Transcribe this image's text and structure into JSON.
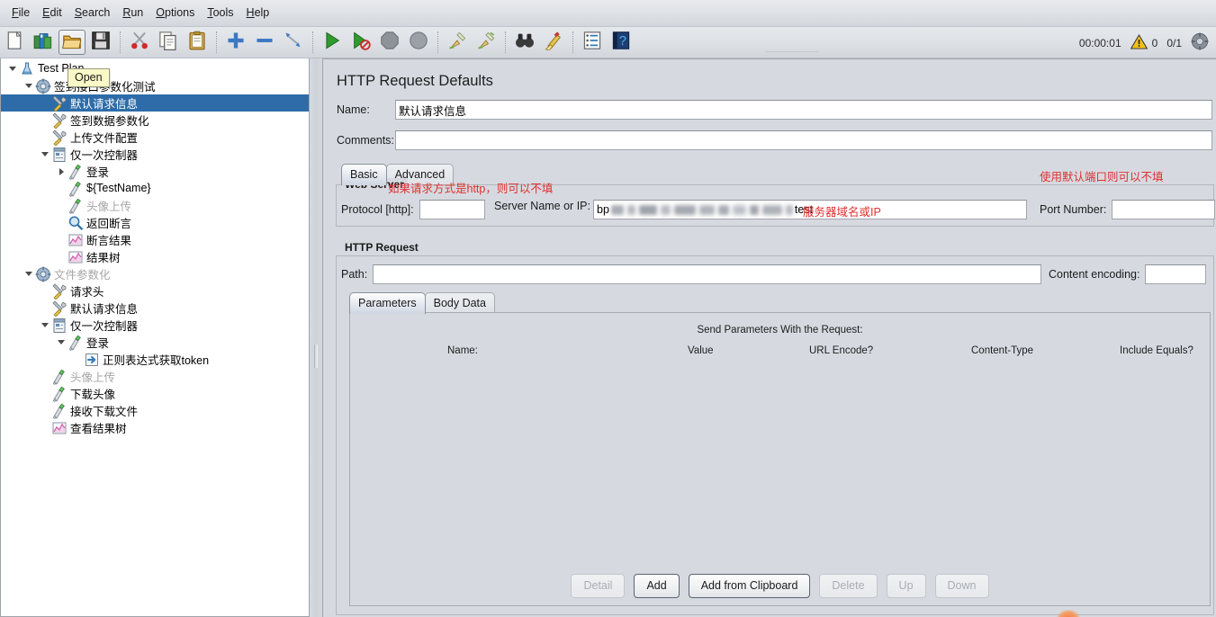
{
  "window": {
    "app": "Apache JMeter",
    "bg_color": "#d6dae0",
    "accent_selection": "#2d6ca8",
    "annotation_color": "#e03030"
  },
  "menubar": {
    "items": [
      {
        "label": "File",
        "mnemonic": "F"
      },
      {
        "label": "Edit",
        "mnemonic": "E"
      },
      {
        "label": "Search",
        "mnemonic": "S"
      },
      {
        "label": "Run",
        "mnemonic": "R"
      },
      {
        "label": "Options",
        "mnemonic": "O"
      },
      {
        "label": "Tools",
        "mnemonic": "T"
      },
      {
        "label": "Help",
        "mnemonic": "H"
      }
    ]
  },
  "toolbar": {
    "groups": [
      [
        {
          "icon": "new-file-icon",
          "title": "New"
        },
        {
          "icon": "templates-icon",
          "title": "Templates"
        },
        {
          "icon": "open-folder-icon",
          "title": "Open",
          "pressed": true
        },
        {
          "icon": "save-floppy-icon",
          "title": "Save Test Plan"
        }
      ],
      [
        {
          "icon": "cut-scissors-icon",
          "title": "Cut"
        },
        {
          "icon": "copy-pages-icon",
          "title": "Copy"
        },
        {
          "icon": "paste-clipboard-icon",
          "title": "Paste"
        }
      ],
      [
        {
          "icon": "expand-plus-icon",
          "title": "Expand All"
        },
        {
          "icon": "collapse-minus-icon",
          "title": "Collapse All"
        },
        {
          "icon": "toggle-branch-icon",
          "title": "Toggle"
        }
      ],
      [
        {
          "icon": "start-play-icon",
          "title": "Start"
        },
        {
          "icon": "start-no-timers-icon",
          "title": "Start no pauses"
        },
        {
          "icon": "stop-octagon-icon",
          "title": "Stop"
        },
        {
          "icon": "shutdown-icon",
          "title": "Shutdown"
        }
      ],
      [
        {
          "icon": "clear-broom-icon",
          "title": "Clear"
        },
        {
          "icon": "clear-all-broom-icon",
          "title": "Clear All"
        }
      ],
      [
        {
          "icon": "search-binoculars-icon",
          "title": "Search"
        },
        {
          "icon": "reset-search-broom-icon",
          "title": "Reset Search"
        }
      ],
      [
        {
          "icon": "function-helper-icon",
          "title": "Function Helper Dialog"
        },
        {
          "icon": "help-book-icon",
          "title": "Help"
        }
      ]
    ],
    "status": {
      "elapsed": "00:00:01",
      "warning_icon": "warning-triangle-icon",
      "warning_count": "0",
      "threads": "0/1",
      "threads_icon": "thread-gear-icon"
    }
  },
  "tooltip": {
    "text": "Open",
    "bg": "#fbf8c8"
  },
  "tree": {
    "items": [
      {
        "depth": 0,
        "toggle": "down",
        "icon": "test-plan-flask-icon",
        "label": "Test Plan",
        "selected": false,
        "disabled": false
      },
      {
        "depth": 1,
        "toggle": "down",
        "icon": "thread-group-gear-icon",
        "label": "签到接口参数化测试",
        "selected": false,
        "disabled": false
      },
      {
        "depth": 2,
        "toggle": "none",
        "icon": "config-wrench-icon",
        "label": "默认请求信息",
        "selected": true,
        "disabled": false
      },
      {
        "depth": 2,
        "toggle": "none",
        "icon": "config-wrench-icon",
        "label": "签到数据参数化",
        "selected": false,
        "disabled": false
      },
      {
        "depth": 2,
        "toggle": "none",
        "icon": "config-wrench-icon",
        "label": "上传文件配置",
        "selected": false,
        "disabled": false
      },
      {
        "depth": 2,
        "toggle": "down",
        "icon": "controller-icon",
        "label": "仅一次控制器",
        "selected": false,
        "disabled": false
      },
      {
        "depth": 3,
        "toggle": "right",
        "icon": "http-sampler-icon",
        "label": "登录",
        "selected": false,
        "disabled": false
      },
      {
        "depth": 3,
        "toggle": "none",
        "icon": "http-sampler-icon",
        "label": "${TestName}",
        "selected": false,
        "disabled": false
      },
      {
        "depth": 3,
        "toggle": "none",
        "icon": "http-sampler-icon",
        "label": "头像上传",
        "selected": false,
        "disabled": true
      },
      {
        "depth": 3,
        "toggle": "none",
        "icon": "assertion-magnifier-icon",
        "label": "返回断言",
        "selected": false,
        "disabled": false
      },
      {
        "depth": 3,
        "toggle": "none",
        "icon": "listener-chart-icon",
        "label": "断言结果",
        "selected": false,
        "disabled": false
      },
      {
        "depth": 3,
        "toggle": "none",
        "icon": "listener-chart-icon",
        "label": "结果树",
        "selected": false,
        "disabled": false
      },
      {
        "depth": 1,
        "toggle": "down",
        "icon": "thread-group-gear-icon",
        "label": "文件参数化",
        "selected": false,
        "disabled": true
      },
      {
        "depth": 2,
        "toggle": "none",
        "icon": "config-wrench-icon",
        "label": "请求头",
        "selected": false,
        "disabled": false
      },
      {
        "depth": 2,
        "toggle": "none",
        "icon": "config-wrench-icon",
        "label": "默认请求信息",
        "selected": false,
        "disabled": false
      },
      {
        "depth": 2,
        "toggle": "down",
        "icon": "controller-icon",
        "label": "仅一次控制器",
        "selected": false,
        "disabled": false
      },
      {
        "depth": 3,
        "toggle": "down",
        "icon": "http-sampler-icon",
        "label": "登录",
        "selected": false,
        "disabled": false
      },
      {
        "depth": 4,
        "toggle": "none",
        "icon": "post-processor-icon",
        "label": "正则表达式获取token",
        "selected": false,
        "disabled": false
      },
      {
        "depth": 2,
        "toggle": "none",
        "icon": "http-sampler-icon",
        "label": "头像上传",
        "selected": false,
        "disabled": true
      },
      {
        "depth": 2,
        "toggle": "none",
        "icon": "http-sampler-icon",
        "label": "下载头像",
        "selected": false,
        "disabled": false
      },
      {
        "depth": 2,
        "toggle": "none",
        "icon": "http-sampler-icon",
        "label": "接收下载文件",
        "selected": false,
        "disabled": false
      },
      {
        "depth": 2,
        "toggle": "none",
        "icon": "listener-chart-icon",
        "label": "查看结果树",
        "selected": false,
        "disabled": false
      }
    ]
  },
  "panel": {
    "title": "HTTP Request Defaults",
    "name_label": "Name:",
    "name_value": "默认请求信息",
    "comments_label": "Comments:",
    "comments_value": "",
    "tabs": [
      {
        "label": "Basic",
        "active": true
      },
      {
        "label": "Advanced",
        "active": false
      }
    ],
    "web_server": {
      "group_title": "Web Server",
      "annotation_protocol": "如果请求方式是http，则可以不填",
      "annotation_port": "使用默认端口则可以不填",
      "protocol_label": "Protocol [http]:",
      "protocol_value": "",
      "server_label": "Server Name or IP:",
      "server_value_prefix": "bp",
      "server_value_suffix": "test",
      "server_annotation": "服务器域名或IP",
      "port_label": "Port Number:",
      "port_value": ""
    },
    "http_request": {
      "group_title": "HTTP Request",
      "path_label": "Path:",
      "path_value": "",
      "content_encoding_label": "Content encoding:",
      "content_encoding_value": "",
      "subtabs": [
        {
          "label": "Parameters",
          "active": true
        },
        {
          "label": "Body Data",
          "active": false
        }
      ],
      "params_caption": "Send Parameters With the Request:",
      "columns": [
        {
          "label": "Name:"
        },
        {
          "label": "Value"
        },
        {
          "label": "URL Encode?"
        },
        {
          "label": "Content-Type"
        },
        {
          "label": "Include Equals?"
        }
      ],
      "rows": [],
      "buttons": [
        {
          "label": "Detail",
          "enabled": false
        },
        {
          "label": "Add",
          "enabled": true,
          "strong": true
        },
        {
          "label": "Add from Clipboard",
          "enabled": true,
          "strong": true
        },
        {
          "label": "Delete",
          "enabled": false
        },
        {
          "label": "Up",
          "enabled": false
        },
        {
          "label": "Down",
          "enabled": false
        }
      ]
    }
  }
}
